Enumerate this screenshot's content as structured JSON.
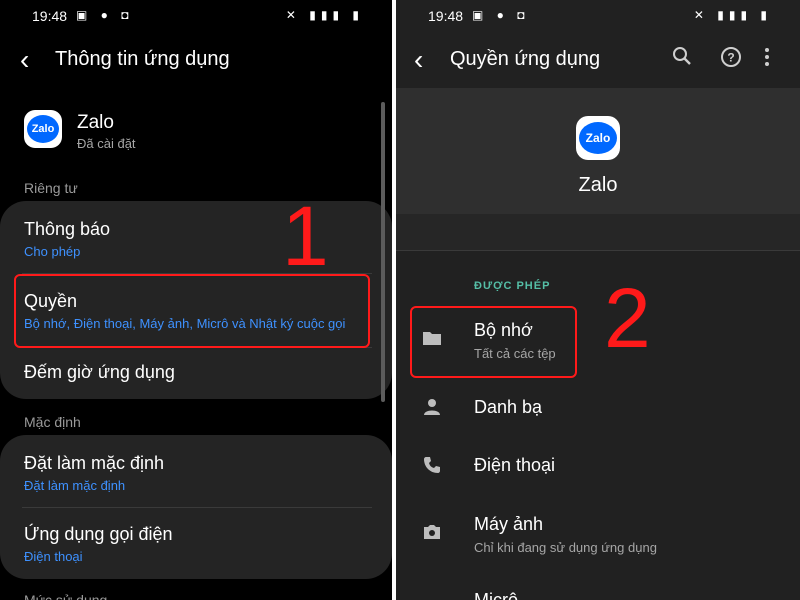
{
  "left": {
    "status": {
      "time": "19:48",
      "icons_left": "▣ ● ◘",
      "icons_right": "✕ ▮▮▮ ▮"
    },
    "title": "Thông tin ứng dụng",
    "app": {
      "logo_text": "Zalo",
      "name": "Zalo",
      "status": "Đã cài đặt"
    },
    "sections": {
      "privacy": "Riêng tư",
      "defaults": "Mặc định",
      "usage": "Mức sử dụng"
    },
    "items": {
      "notifications": {
        "title": "Thông báo",
        "subtitle": "Cho phép"
      },
      "permissions": {
        "title": "Quyền",
        "subtitle": "Bộ nhớ, Điện thoại, Máy ảnh, Micrô và Nhật ký cuộc gọi"
      },
      "screen_time": {
        "title": "Đếm giờ ứng dụng"
      },
      "set_default": {
        "title": "Đặt làm mặc định",
        "subtitle": "Đặt làm mặc định"
      },
      "call_app": {
        "title": "Ứng dụng gọi điện",
        "subtitle": "Điện thoại"
      }
    },
    "annotation_number": "1"
  },
  "right": {
    "status": {
      "time": "19:48",
      "icons_left": "▣ ● ◘",
      "icons_right": "✕ ▮▮▮ ▮"
    },
    "title": "Quyền ứng dụng",
    "app": {
      "logo_text": "Zalo",
      "name": "Zalo"
    },
    "allowed_label": "ĐƯỢC PHÉP",
    "permissions": [
      {
        "title": "Bộ nhớ",
        "subtitle": "Tất cả các tệp",
        "icon": "folder-icon"
      },
      {
        "title": "Danh bạ",
        "subtitle": "",
        "icon": "person-icon"
      },
      {
        "title": "Điện thoại",
        "subtitle": "",
        "icon": "phone-icon"
      },
      {
        "title": "Máy ảnh",
        "subtitle": "Chỉ khi đang sử dụng ứng dụng",
        "icon": "camera-icon"
      },
      {
        "title": "Micrô",
        "subtitle": "",
        "icon": "microphone-icon"
      }
    ],
    "annotation_number": "2"
  },
  "colors": {
    "accent_blue": "#3e91ff",
    "allowed_teal": "#55bfa7",
    "annotation_red": "#ff1a1a"
  }
}
